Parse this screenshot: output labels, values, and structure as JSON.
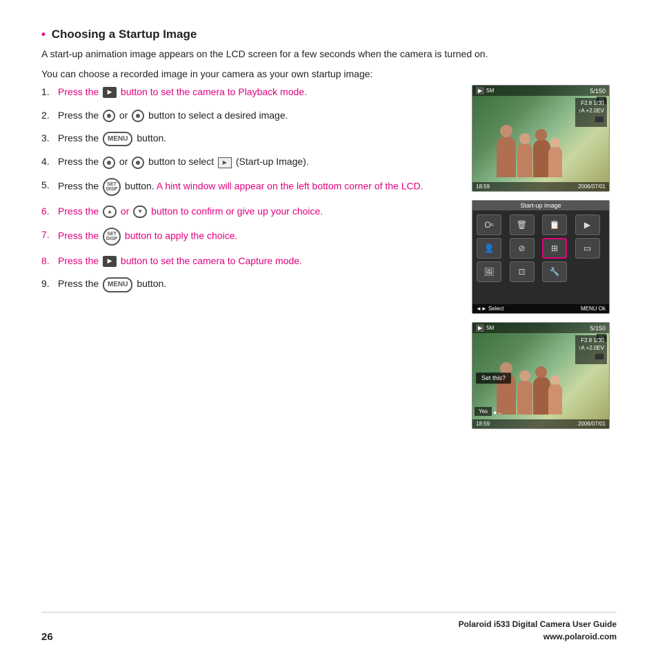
{
  "page": {
    "title": "Choosing a Startup Image",
    "intro1": "A start-up animation image appears on the LCD screen for a few seconds when the camera is turned on.",
    "intro2": "You can choose a recorded image in your camera as your own startup image:",
    "steps": [
      {
        "num": "1.",
        "text_before": "Press the",
        "icon": "playback",
        "text_after": "button to set the camera to Playback mode.",
        "pink": true
      },
      {
        "num": "2.",
        "text_before": "Press the",
        "icon": "wheel-or",
        "text_after": "button to select a desired image.",
        "pink": false
      },
      {
        "num": "3.",
        "text_before": "Press the",
        "icon": "menu",
        "text_after": "button.",
        "pink": false
      },
      {
        "num": "4.",
        "text_before": "Press the",
        "icon": "wheel-or2",
        "text_after": "button to select",
        "icon2": "startup",
        "text_after2": "(Start-up Image).",
        "pink": false
      },
      {
        "num": "5.",
        "text_before": "Press the",
        "icon": "set",
        "text_after": "button. A hint window will appear on the left bottom corner of the LCD.",
        "pink": true
      },
      {
        "num": "6.",
        "text_before": "Press the",
        "icon": "scroll",
        "text_after": "or",
        "icon2": "scroll2",
        "text_after2": "button to confirm or give up your choice.",
        "pink": true
      },
      {
        "num": "7.",
        "text_before": "Press the",
        "icon": "set2",
        "text_after": "button to apply the choice.",
        "pink": true
      },
      {
        "num": "8.",
        "text_before": "Press the",
        "icon": "playback2",
        "text_after": "button to set the camera to Capture mode.",
        "pink": true
      },
      {
        "num": "9.",
        "text_before": "Press the",
        "icon": "menu2",
        "text_after": "button.",
        "pink": false
      }
    ],
    "screen1": {
      "counter": "5/150",
      "mode_icon": "▶",
      "storage": "IN",
      "settings": "F2.8  1/30\n↑A  +2.0EV",
      "time": "18:59",
      "date": "2006/07/01"
    },
    "screen2": {
      "title": "Start-up image",
      "bottom_left": "◄► Select",
      "bottom_right": "MENU Ok"
    },
    "screen3": {
      "counter": "5/150",
      "storage": "IN",
      "settings": "F2.8  1/30\n↑A  +2.0EV",
      "prompt": "Set this?",
      "yes": "Yes",
      "arrow": "●←",
      "time": "18:59",
      "date": "2006/07/01"
    },
    "footer": {
      "page_num": "26",
      "brand": "Polaroid i533 Digital Camera User Guide",
      "website": "www.polaroid.com"
    }
  }
}
